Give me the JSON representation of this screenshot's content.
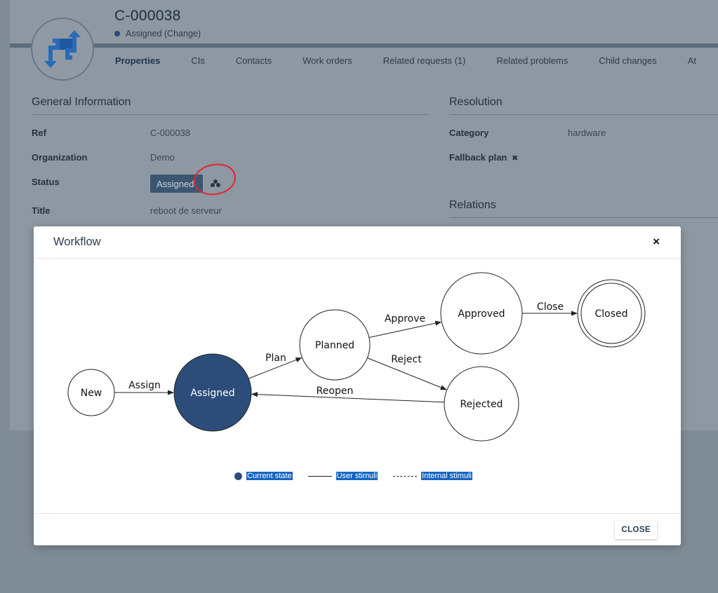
{
  "header": {
    "ref": "C-000038",
    "status_line": "Assigned (Change)"
  },
  "tabs": [
    "Properties",
    "CIs",
    "Contacts",
    "Work orders",
    "Related requests (1)",
    "Related problems",
    "Child changes",
    "At"
  ],
  "general": {
    "title": "General Information",
    "fields": [
      {
        "label": "Ref",
        "value": "C-000038"
      },
      {
        "label": "Organization",
        "value": "Demo"
      },
      {
        "label": "Status",
        "value": "Assigned"
      },
      {
        "label": "Title",
        "value": "reboot de serveur"
      }
    ]
  },
  "resolution": {
    "title": "Resolution",
    "category_label": "Category",
    "category_value": "hardware",
    "fallback_label": "Fallback plan"
  },
  "relations": {
    "title": "Relations"
  },
  "modal": {
    "title": "Workflow",
    "close_label": "CLOSE",
    "close_x": "×"
  },
  "workflow": {
    "states": [
      {
        "id": "new",
        "label": "New",
        "current": false,
        "final": false
      },
      {
        "id": "assigned",
        "label": "Assigned",
        "current": true,
        "final": false
      },
      {
        "id": "planned",
        "label": "Planned",
        "current": false,
        "final": false
      },
      {
        "id": "approved",
        "label": "Approved",
        "current": false,
        "final": false
      },
      {
        "id": "rejected",
        "label": "Rejected",
        "current": false,
        "final": false
      },
      {
        "id": "closed",
        "label": "Closed",
        "current": false,
        "final": true
      }
    ],
    "transitions": [
      {
        "from": "new",
        "to": "assigned",
        "label": "Assign"
      },
      {
        "from": "assigned",
        "to": "planned",
        "label": "Plan"
      },
      {
        "from": "planned",
        "to": "approved",
        "label": "Approve"
      },
      {
        "from": "planned",
        "to": "rejected",
        "label": "Reject"
      },
      {
        "from": "approved",
        "to": "closed",
        "label": "Close"
      },
      {
        "from": "rejected",
        "to": "assigned",
        "label": "Reopen"
      }
    ]
  },
  "legend": {
    "current": "Current state",
    "user": "User stimuli",
    "internal": "Internal stimuli"
  },
  "colors": {
    "current_state": "#2c4d7a",
    "annotation": "#e3262e",
    "status_pill": "#3c5672"
  }
}
